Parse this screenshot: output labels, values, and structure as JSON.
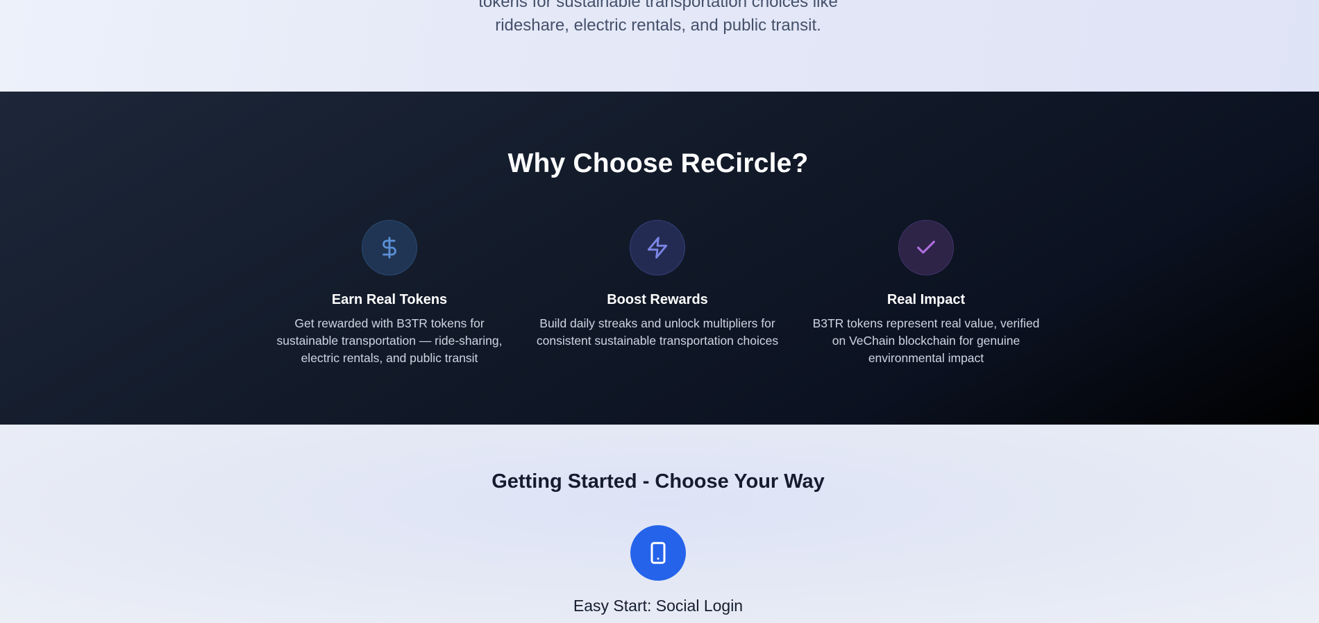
{
  "hero": {
    "line1": "tokens for sustainable transportation choices like",
    "line2": "rideshare, electric rentals, and public transit."
  },
  "why": {
    "title": "Why Choose ReCircle?",
    "features": [
      {
        "icon": "dollar-icon",
        "title": "Earn Real Tokens",
        "desc": "Get rewarded with B3TR tokens for sustainable transportation — ride-sharing, electric rentals, and public transit",
        "icon_color": "#5b8fd6"
      },
      {
        "icon": "lightning-icon",
        "title": "Boost Rewards",
        "desc": "Build daily streaks and unlock multipliers for consistent sustainable transportation choices",
        "icon_color": "#7b86e6"
      },
      {
        "icon": "check-icon",
        "title": "Real Impact",
        "desc": "B3TR tokens represent real value, verified on VeChain blockchain for genuine environmental impact",
        "icon_color": "#b06ee0"
      }
    ]
  },
  "start": {
    "title": "Getting Started - Choose Your Way",
    "option_title": "Easy Start: Social Login",
    "icon": "phone-icon",
    "accent": "#2563eb"
  }
}
